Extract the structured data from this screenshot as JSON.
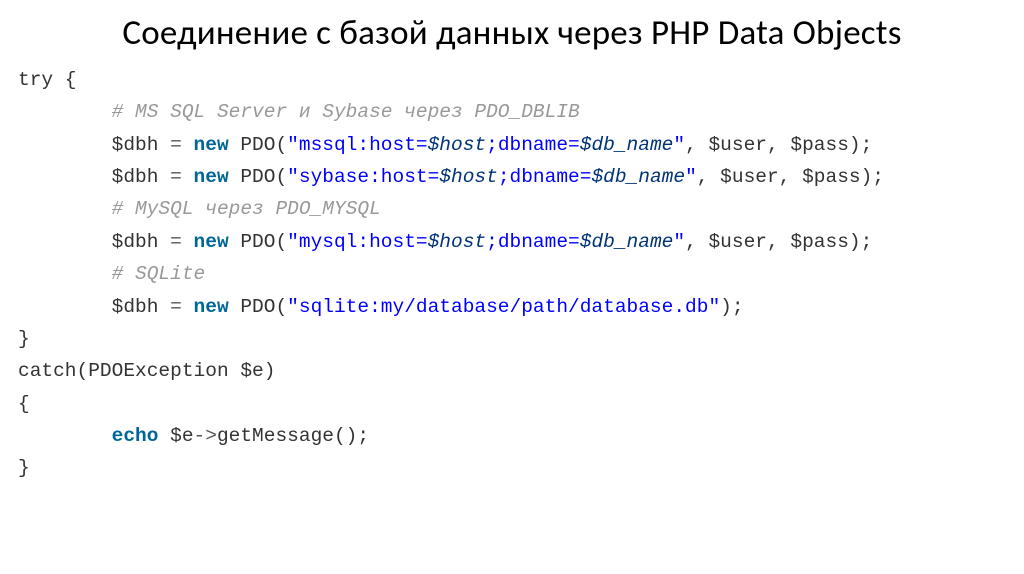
{
  "title": "Соединение с базой данных через PHP Data Objects",
  "code": {
    "l1_try": "try",
    "l1_brace": " {",
    "indent": "        ",
    "c1": "# MS SQL Server и Sybase через PDO_DBLIB",
    "assign_dbh": "$dbh ",
    "eq": "= ",
    "new": "new",
    "pdo": " PDO(",
    "s_ms_a": "\"mssql:host=",
    "v_host": "$host",
    "s_ms_b": ";dbname=",
    "v_db": "$db_name",
    "s_ms_c": "\"",
    "comma_sp": ", ",
    "v_user": "$user",
    "v_pass": "$pass",
    "rpar_semi": ");",
    "s_sy_a": "\"sybase:host=",
    "s_sy_b": ";dbname=",
    "s_sy_c": "\"",
    "c2": "# MySQL через PDO_MYSQL",
    "s_my_a": "\"mysql:host=",
    "s_my_b": ";dbname=",
    "s_my_c": "\"",
    "c3": "# SQLite",
    "s_sqlite": "\"sqlite:my/database/path/database.db\"",
    "rbrace": "}",
    "catch": "catch",
    "catch_args_open": "(PDOException ",
    "v_e": "$e",
    "catch_args_close": ")",
    "lbrace": "{",
    "echo": "echo",
    "sp": " ",
    "arrow": "->",
    "getmsg": "getMessage();"
  }
}
